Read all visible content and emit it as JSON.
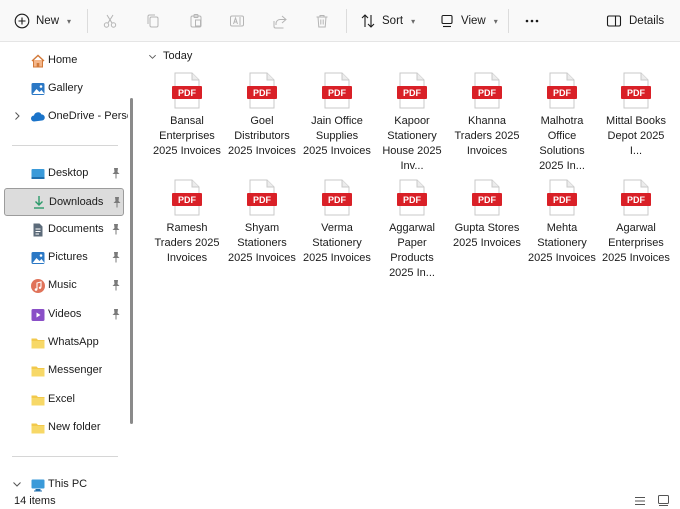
{
  "toolbar": {
    "new_label": "New",
    "sort_label": "Sort",
    "view_label": "View",
    "details_label": "Details"
  },
  "sidebar": {
    "items": [
      {
        "label": "Home"
      },
      {
        "label": "Gallery"
      },
      {
        "label": "OneDrive - Perso"
      },
      {
        "label": "Desktop"
      },
      {
        "label": "Downloads"
      },
      {
        "label": "Documents"
      },
      {
        "label": "Pictures"
      },
      {
        "label": "Music"
      },
      {
        "label": "Videos"
      },
      {
        "label": "WhatsApp"
      },
      {
        "label": "Messenger"
      },
      {
        "label": "Excel"
      },
      {
        "label": "New folder"
      },
      {
        "label": "This PC"
      }
    ]
  },
  "main": {
    "group_label": "Today",
    "file_badge": "PDF",
    "files": [
      {
        "name": "Bansal Enterprises 2025 Invoices"
      },
      {
        "name": "Goel Distributors 2025 Invoices"
      },
      {
        "name": "Jain Office Supplies 2025 Invoices"
      },
      {
        "name": "Kapoor Stationery House 2025 Inv..."
      },
      {
        "name": "Khanna Traders 2025 Invoices"
      },
      {
        "name": "Malhotra Office Solutions 2025 In..."
      },
      {
        "name": "Mittal Books Depot 2025 I..."
      },
      {
        "name": "Ramesh Traders 2025 Invoices"
      },
      {
        "name": "Shyam Stationers 2025 Invoices"
      },
      {
        "name": "Verma Stationery 2025 Invoices"
      },
      {
        "name": "Aggarwal Paper Products 2025 In..."
      },
      {
        "name": "Gupta Stores 2025 Invoices"
      },
      {
        "name": "Mehta Stationery 2025 Invoices"
      },
      {
        "name": "Agarwal Enterprises 2025 Invoices"
      }
    ]
  },
  "status": {
    "item_count": "14 items"
  },
  "colors": {
    "pdf_red": "#d92027",
    "folder_yellow": "#f2c94c",
    "selection_bg": "#dcdcdc",
    "accent_blue": "#1a73c9"
  }
}
